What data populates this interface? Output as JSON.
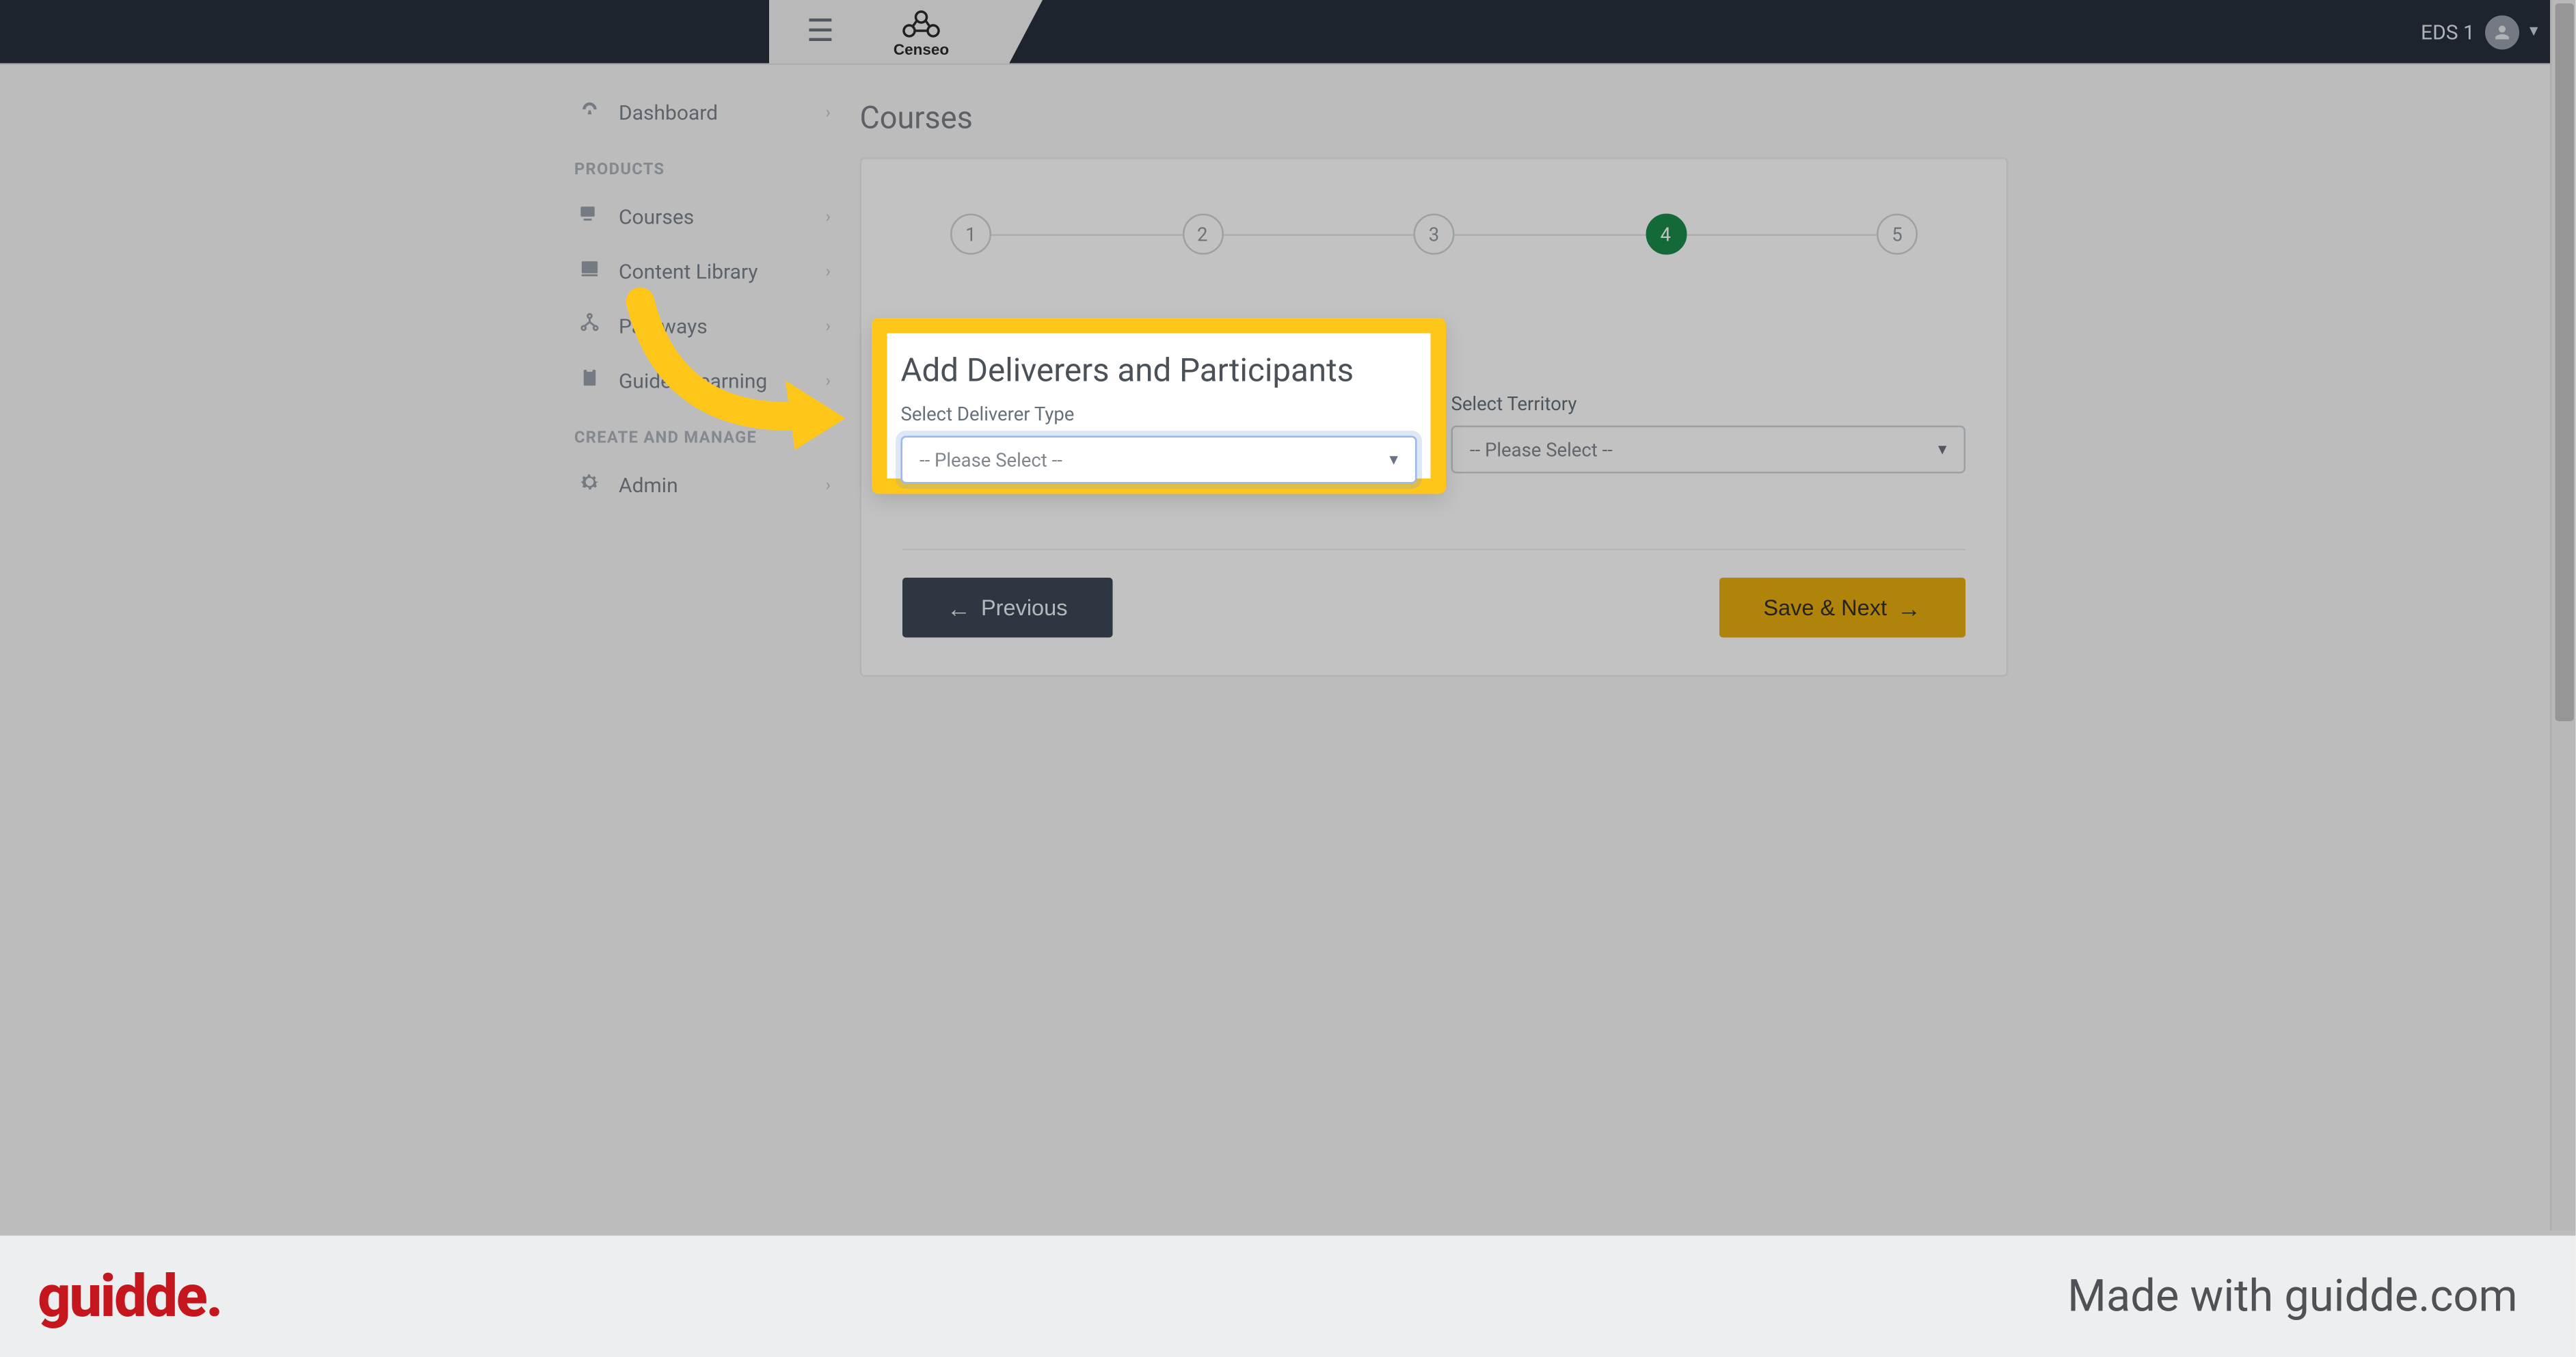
{
  "topbar": {
    "user_label": "EDS 1",
    "logo_text": "Censeo"
  },
  "sidebar": {
    "item_dashboard": "Dashboard",
    "section_products": "PRODUCTS",
    "item_courses": "Courses",
    "item_content_library": "Content Library",
    "item_pathways": "Pathways",
    "item_guided_learning": "Guided Learning",
    "section_create": "CREATE AND MANAGE",
    "item_admin": "Admin"
  },
  "page": {
    "title": "Courses"
  },
  "steps": {
    "s1": "1",
    "s2": "2",
    "s3": "3",
    "s4": "4",
    "s5": "5",
    "active_index": 4
  },
  "form": {
    "heading": "Add Deliverers and Participants",
    "deliverer_label": "Select Deliverer Type",
    "deliverer_value": "-- Please Select --",
    "territory_label": "Select Territory",
    "territory_value": "-- Please Select --"
  },
  "buttons": {
    "previous": "Previous",
    "next": "Save & Next"
  },
  "footer": {
    "logo": "guidde.",
    "right_text": "Made with guidde.com"
  }
}
